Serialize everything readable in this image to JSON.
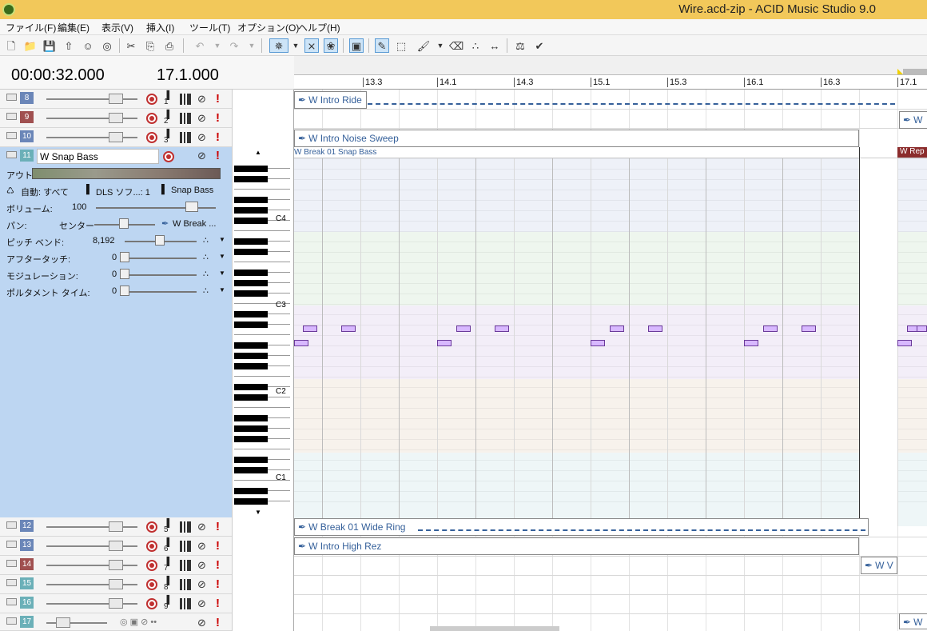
{
  "window": {
    "title": "Wire.acd-zip - ACID Music Studio 9.0"
  },
  "menu": [
    "ファイル(F)",
    "編集(E)",
    "表示(V)",
    "挿入(I)",
    "ツール(T)",
    "オプション(O)",
    "ヘルプ(H)"
  ],
  "time": {
    "position": "00:00:32.000",
    "measure": "17.1.000"
  },
  "ruler": [
    "13.3",
    "14.1",
    "14.3",
    "15.1",
    "15.3",
    "16.1",
    "16.3",
    "17.1"
  ],
  "tracks_top": [
    {
      "num": "8",
      "ch": "1",
      "color": "#6b86b8"
    },
    {
      "num": "9",
      "ch": "2",
      "color": "#a05050"
    },
    {
      "num": "10",
      "ch": "3",
      "color": "#6b86b8"
    }
  ],
  "expanded": {
    "num": "11",
    "name": "W Snap Bass",
    "out_label": "アウト",
    "auto_label": "自動: すべて",
    "dls_label": "DLS ソフ...: 1",
    "synth_label": "Snap Bass",
    "volume_label": "ボリューム:",
    "volume_value": "100",
    "pan_label": "パン:",
    "pan_value": "センター",
    "clip_ref": "W Break ...",
    "pitch_label": "ピッチ ベンド:",
    "pitch_value": "8,192",
    "after_label": "アフタータッチ:",
    "after_value": "0",
    "mod_label": "モジュレーション:",
    "mod_value": "0",
    "porta_label": "ポルタメント タイム:",
    "porta_value": "0"
  },
  "tracks_bottom": [
    {
      "num": "12",
      "ch": "5",
      "color": "#6b86b8"
    },
    {
      "num": "13",
      "ch": "6",
      "color": "#6b86b8"
    },
    {
      "num": "14",
      "ch": "7",
      "color": "#a05050"
    },
    {
      "num": "15",
      "ch": "8",
      "color": "#6bb0b8"
    },
    {
      "num": "16",
      "ch": "9",
      "color": "#6bb0b8"
    },
    {
      "num": "17",
      "ch": "",
      "color": "#6bb0b8"
    }
  ],
  "octaves": [
    "C4",
    "C3",
    "C2",
    "C1"
  ],
  "clips": {
    "t8": "W Intro Ride",
    "t9": "W",
    "t10": "W Intro Noise Sweep",
    "t11": "W Break 01 Snap Bass",
    "t11b": "W Rep",
    "t12": "W Break 01 Wide Ring",
    "t13": "W Intro High Rez",
    "t14": "W V",
    "t17": "W"
  }
}
